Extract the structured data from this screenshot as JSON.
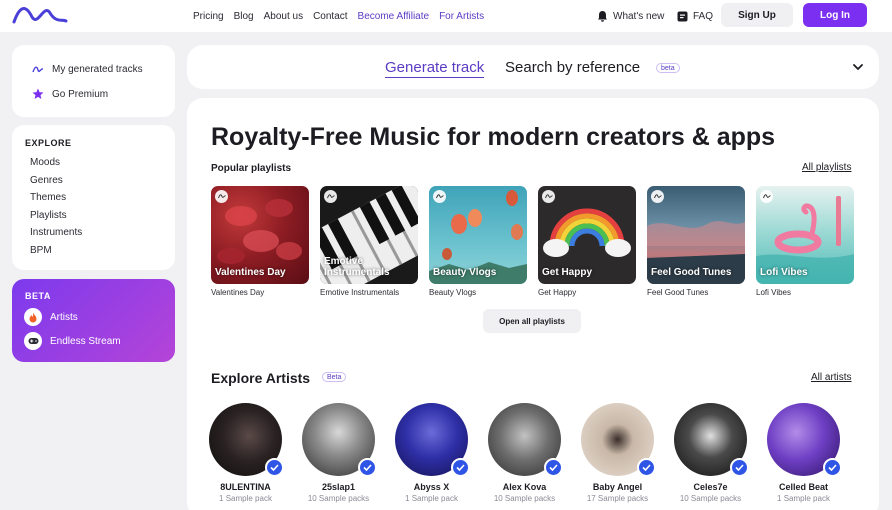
{
  "nav": {
    "links": [
      "Pricing",
      "Blog",
      "About us",
      "Contact"
    ],
    "affiliate": "Become Affiliate",
    "artists": "For Artists",
    "whats_new": "What's new",
    "faq": "FAQ",
    "signup": "Sign Up",
    "login": "Log In"
  },
  "sidebar": {
    "my_tracks": "My generated tracks",
    "premium": "Go Premium",
    "explore_title": "EXPLORE",
    "explore_items": [
      "Moods",
      "Genres",
      "Themes",
      "Playlists",
      "Instruments",
      "BPM"
    ],
    "beta_title": "BETA",
    "beta_items": [
      "Artists",
      "Endless Stream"
    ]
  },
  "tabs": {
    "generate": "Generate track",
    "search": "Search by reference",
    "beta": "beta"
  },
  "main": {
    "headline": "Royalty-Free Music for modern creators & apps",
    "popular_label": "Popular playlists",
    "all_playlists": "All playlists",
    "playlists": [
      {
        "title": "Valentines Day",
        "overlay": "Valentines Day"
      },
      {
        "title": "Emotive Instrumentals",
        "overlay": "Emotive Instrumentals"
      },
      {
        "title": "Beauty Vlogs",
        "overlay": "Beauty Vlogs"
      },
      {
        "title": "Get Happy",
        "overlay": "Get Happy"
      },
      {
        "title": "Feel Good Tunes",
        "overlay": "Feel Good Tunes"
      },
      {
        "title": "Lofi Vibes",
        "overlay": "Lofi Vibes"
      }
    ],
    "open_all": "Open all playlists",
    "artists_title": "Explore Artists",
    "artists_beta": "Beta",
    "all_artists": "All artists",
    "artists": [
      {
        "name": "8ULENTINA",
        "packs": "1 Sample pack"
      },
      {
        "name": "25slap1",
        "packs": "10 Sample packs"
      },
      {
        "name": "Abyss X",
        "packs": "1 Sample pack"
      },
      {
        "name": "Alex Kova",
        "packs": "10 Sample packs"
      },
      {
        "name": "Baby Angel",
        "packs": "17 Sample packs"
      },
      {
        "name": "Celes7e",
        "packs": "10 Sample packs"
      },
      {
        "name": "Celled Beat",
        "packs": "1 Sample pack"
      }
    ]
  },
  "colors": {
    "accent": "#5b3cc4",
    "login": "#7b2ff0",
    "beta_gradient_start": "#7c3aed",
    "beta_gradient_end": "#b544d8",
    "verified": "#2f55e6"
  }
}
